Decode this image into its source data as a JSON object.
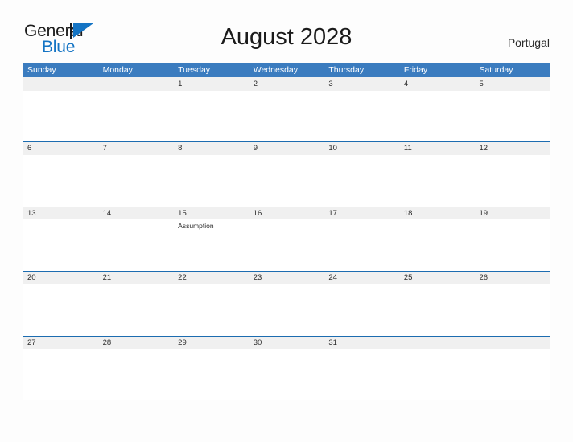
{
  "brand": {
    "name_part1": "General",
    "name_part2": "Blue",
    "flag_icon": "flag-triangle-icon",
    "accent_color": "#1474c4"
  },
  "header": {
    "title": "August 2028",
    "region": "Portugal"
  },
  "colors": {
    "header_blue": "#3b7cbf",
    "rule_blue": "#1c6cb0",
    "band_gray": "#f0f0f0",
    "page_background": "#fdfdfd",
    "text_dark": "#2b2b2b"
  },
  "calendar": {
    "month": "August",
    "year": "2028",
    "weekday_headers": [
      "Sunday",
      "Monday",
      "Tuesday",
      "Wednesday",
      "Thursday",
      "Friday",
      "Saturday"
    ],
    "weeks": [
      {
        "has_top_rule": false,
        "days": [
          {
            "number": "",
            "events": []
          },
          {
            "number": "",
            "events": []
          },
          {
            "number": "1",
            "events": []
          },
          {
            "number": "2",
            "events": []
          },
          {
            "number": "3",
            "events": []
          },
          {
            "number": "4",
            "events": []
          },
          {
            "number": "5",
            "events": []
          }
        ]
      },
      {
        "has_top_rule": true,
        "days": [
          {
            "number": "6",
            "events": []
          },
          {
            "number": "7",
            "events": []
          },
          {
            "number": "8",
            "events": []
          },
          {
            "number": "9",
            "events": []
          },
          {
            "number": "10",
            "events": []
          },
          {
            "number": "11",
            "events": []
          },
          {
            "number": "12",
            "events": []
          }
        ]
      },
      {
        "has_top_rule": true,
        "days": [
          {
            "number": "13",
            "events": []
          },
          {
            "number": "14",
            "events": []
          },
          {
            "number": "15",
            "events": [
              "Assumption"
            ]
          },
          {
            "number": "16",
            "events": []
          },
          {
            "number": "17",
            "events": []
          },
          {
            "number": "18",
            "events": []
          },
          {
            "number": "19",
            "events": []
          }
        ]
      },
      {
        "has_top_rule": true,
        "days": [
          {
            "number": "20",
            "events": []
          },
          {
            "number": "21",
            "events": []
          },
          {
            "number": "22",
            "events": []
          },
          {
            "number": "23",
            "events": []
          },
          {
            "number": "24",
            "events": []
          },
          {
            "number": "25",
            "events": []
          },
          {
            "number": "26",
            "events": []
          }
        ]
      },
      {
        "has_top_rule": true,
        "days": [
          {
            "number": "27",
            "events": []
          },
          {
            "number": "28",
            "events": []
          },
          {
            "number": "29",
            "events": []
          },
          {
            "number": "30",
            "events": []
          },
          {
            "number": "31",
            "events": []
          },
          {
            "number": "",
            "events": []
          },
          {
            "number": "",
            "events": []
          }
        ]
      }
    ]
  }
}
